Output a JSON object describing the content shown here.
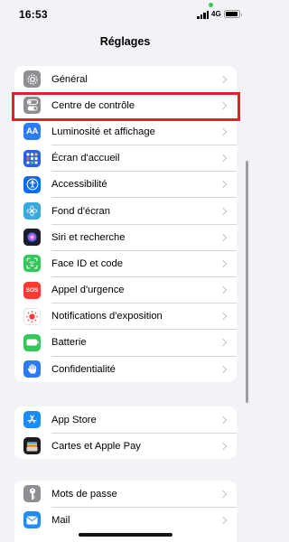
{
  "status": {
    "time": "16:53",
    "network": "4G"
  },
  "header": {
    "title": "Réglages"
  },
  "colors": {
    "background": "#f2f2f7",
    "highlight": "#e0202b",
    "icon_gray": "#8e8e93",
    "icon_blue": "#2c7cf6",
    "icon_blue_dark": "#0a6cf0",
    "icon_green": "#34c759",
    "icon_red": "#ff3b30"
  },
  "groups": [
    {
      "items": [
        {
          "label": "Général",
          "icon": "gear-icon"
        },
        {
          "label": "Centre de contrôle",
          "icon": "toggles-icon",
          "highlighted": true
        },
        {
          "label": "Luminosité et affichage",
          "icon": "text-size-icon"
        },
        {
          "label": "Écran d'accueil",
          "icon": "home-grid-icon"
        },
        {
          "label": "Accessibilité",
          "icon": "accessibility-icon"
        },
        {
          "label": "Fond d'écran",
          "icon": "flower-icon"
        },
        {
          "label": "Siri et recherche",
          "icon": "siri-icon"
        },
        {
          "label": "Face ID et code",
          "icon": "face-id-icon"
        },
        {
          "label": "Appel d'urgence",
          "icon": "sos-icon"
        },
        {
          "label": "Notifications d'exposition",
          "icon": "exposure-icon"
        },
        {
          "label": "Batterie",
          "icon": "battery-icon"
        },
        {
          "label": "Confidentialité",
          "icon": "hand-icon"
        }
      ]
    },
    {
      "items": [
        {
          "label": "App Store",
          "icon": "app-store-icon"
        },
        {
          "label": "Cartes et Apple Pay",
          "icon": "wallet-icon"
        }
      ]
    },
    {
      "items": [
        {
          "label": "Mots de passe",
          "icon": "key-icon"
        },
        {
          "label": "Mail",
          "icon": "mail-icon"
        }
      ]
    }
  ],
  "sos_text": "SOS"
}
